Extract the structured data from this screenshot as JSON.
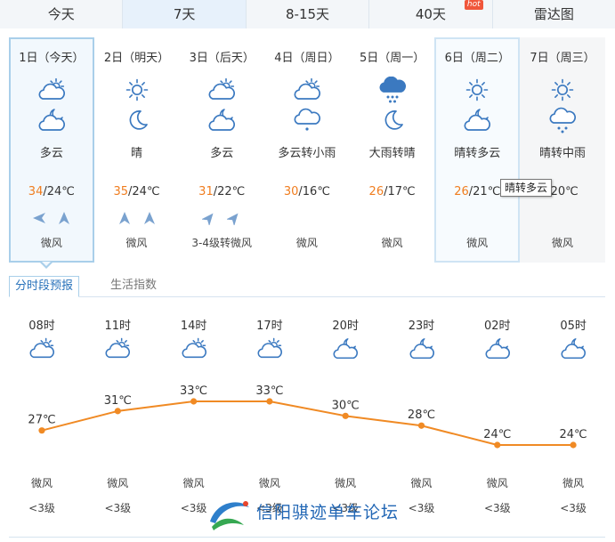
{
  "tabs": [
    {
      "label": "今天",
      "active": false
    },
    {
      "label": "7天",
      "active": true
    },
    {
      "label": "8-15天",
      "active": false
    },
    {
      "label": "40天",
      "active": false,
      "badge": "hot"
    },
    {
      "label": "雷达图",
      "active": false
    }
  ],
  "days": [
    {
      "date": "1日（今天）",
      "icon_day": "partly-cloudy-day-icon",
      "icon_night": "cloudy-night-icon",
      "desc": "多云",
      "high": "34",
      "low": "/24℃",
      "wind_dirs": [
        "west",
        "north"
      ],
      "wind": "微风"
    },
    {
      "date": "2日（明天）",
      "icon_day": "sun-icon",
      "icon_night": "moon-icon",
      "desc": "晴",
      "high": "35",
      "low": "/24℃",
      "wind_dirs": [
        "north",
        "north"
      ],
      "wind": "微风"
    },
    {
      "date": "3日（后天）",
      "icon_day": "partly-cloudy-day-icon",
      "icon_night": "cloudy-night-icon",
      "desc": "多云",
      "high": "31",
      "low": "/22℃",
      "wind_dirs": [
        "northeast",
        "northeast"
      ],
      "wind": "3-4级转微风"
    },
    {
      "date": "4日（周日）",
      "icon_day": "partly-cloudy-day-icon",
      "icon_night": "light-rain-icon",
      "desc": "多云转小雨",
      "high": "30",
      "low": "/16℃",
      "wind_dirs": [],
      "wind": "微风"
    },
    {
      "date": "5日（周一）",
      "icon_day": "heavy-rain-icon",
      "icon_night": "moon-icon",
      "desc": "大雨转晴",
      "high": "26",
      "low": "/17℃",
      "wind_dirs": [],
      "wind": "微风"
    },
    {
      "date": "6日（周二）",
      "icon_day": "sun-icon",
      "icon_night": "cloudy-night-icon",
      "desc": "晴转多云",
      "high": "26",
      "low": "/21℃",
      "wind_dirs": [],
      "wind": "微风"
    },
    {
      "date": "7日（周三）",
      "icon_day": "sun-icon",
      "icon_night": "moderate-rain-icon",
      "desc": "晴转中雨",
      "high": "",
      "low": "/20℃",
      "wind_dirs": [],
      "wind": "微风"
    }
  ],
  "tooltip": "晴转多云",
  "subtabs": {
    "active": "分时段预报",
    "inactive": "生活指数"
  },
  "hourly": [
    {
      "time": "08时",
      "icon": "partly-cloudy-day-icon",
      "temp": 27,
      "temp_label": "27℃",
      "wind": "微风",
      "level": "<3级"
    },
    {
      "time": "11时",
      "icon": "partly-cloudy-day-icon",
      "temp": 31,
      "temp_label": "31℃",
      "wind": "微风",
      "level": "<3级"
    },
    {
      "time": "14时",
      "icon": "partly-cloudy-day-icon",
      "temp": 33,
      "temp_label": "33℃",
      "wind": "微风",
      "level": "<3级"
    },
    {
      "time": "17时",
      "icon": "partly-cloudy-day-icon",
      "temp": 33,
      "temp_label": "33℃",
      "wind": "微风",
      "level": "<3级"
    },
    {
      "time": "20时",
      "icon": "cloudy-night-icon",
      "temp": 30,
      "temp_label": "30℃",
      "wind": "微风",
      "level": "<3级"
    },
    {
      "time": "23时",
      "icon": "cloudy-night-icon",
      "temp": 28,
      "temp_label": "28℃",
      "wind": "微风",
      "level": "<3级"
    },
    {
      "time": "02时",
      "icon": "cloudy-night-icon",
      "temp": 24,
      "temp_label": "24℃",
      "wind": "微风",
      "level": "<3级"
    },
    {
      "time": "05时",
      "icon": "cloudy-night-icon",
      "temp": 24,
      "temp_label": "24℃",
      "wind": "微风",
      "level": "<3级"
    }
  ],
  "watermark": "信阳骐迹单车论坛",
  "colors": {
    "accent": "#2a73bb",
    "temp_high": "#f07d1f",
    "line": "#f08a24",
    "icon": "#3b79c0"
  }
}
